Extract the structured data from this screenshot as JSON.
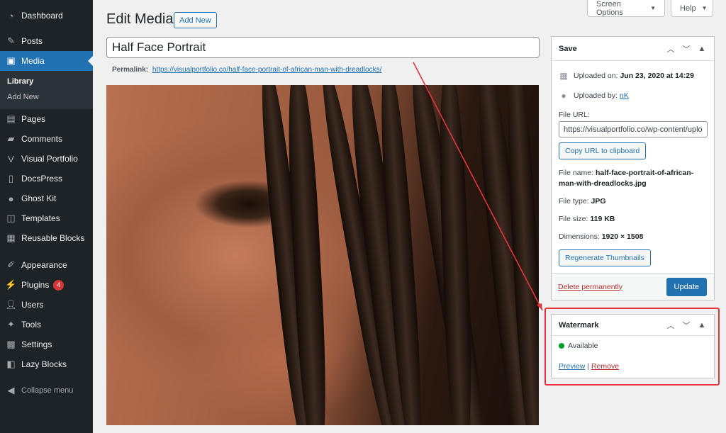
{
  "sidebar": {
    "dashboard": "Dashboard",
    "posts": "Posts",
    "media": "Media",
    "submenu": {
      "library": "Library",
      "add_new": "Add New"
    },
    "pages": "Pages",
    "comments": "Comments",
    "visual_portfolio": "Visual Portfolio",
    "docspress": "DocsPress",
    "ghost_kit": "Ghost Kit",
    "templates": "Templates",
    "reusable_blocks": "Reusable Blocks",
    "appearance": "Appearance",
    "plugins": "Plugins",
    "plugins_badge": "4",
    "users": "Users",
    "tools": "Tools",
    "settings": "Settings",
    "lazy_blocks": "Lazy Blocks",
    "collapse": "Collapse menu"
  },
  "top": {
    "screen_options": "Screen Options",
    "help": "Help"
  },
  "header": {
    "title": "Edit Media",
    "add_new": "Add New"
  },
  "media": {
    "title_value": "Half Face Portrait",
    "permalink_label": "Permalink:",
    "permalink_url": "https://visualportfolio.co/half-face-portrait-of-african-man-with-dreadlocks/"
  },
  "save_box": {
    "title": "Save",
    "uploaded_on_label": "Uploaded on:",
    "uploaded_on_value": "Jun 23, 2020 at 14:29",
    "uploaded_by_label": "Uploaded by:",
    "uploaded_by_value": "nK",
    "file_url_label": "File URL:",
    "file_url_value": "https://visualportfolio.co/wp-content/uploads/",
    "copy_url": "Copy URL to clipboard",
    "file_name_label": "File name:",
    "file_name_line1": "half-face-portrait-of-african-",
    "file_name_line2": "man-with-dreadlocks.jpg",
    "file_type_label": "File type:",
    "file_type_value": "JPG",
    "file_size_label": "File size:",
    "file_size_value": "119 KB",
    "dimensions_label": "Dimensions:",
    "dimensions_value": "1920 × 1508",
    "regenerate": "Regenerate Thumbnails",
    "delete": "Delete permanently",
    "update": "Update"
  },
  "watermark_box": {
    "title": "Watermark",
    "status": "Available",
    "preview": "Preview",
    "separator": "|",
    "remove": "Remove"
  },
  "colors": {
    "accent": "#2271b1",
    "sidebar": "#1d2327",
    "highlight": "#e5343b",
    "available": "#00a32a"
  }
}
